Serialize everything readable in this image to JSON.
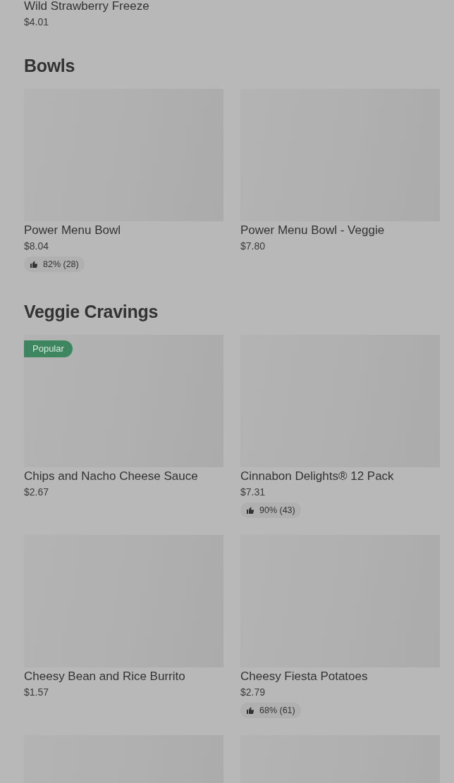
{
  "top_item": {
    "title": "Wild Strawberry Freeze",
    "price": "$4.01"
  },
  "sections": [
    {
      "heading": "Bowls",
      "items": [
        {
          "kind": "product",
          "title": "Power Menu Bowl",
          "price": "$8.04",
          "rating": "82% (28)"
        },
        {
          "kind": "product",
          "title": "Power Menu Bowl - Veggie",
          "price": "$7.80"
        }
      ]
    },
    {
      "heading": "Veggie Cravings",
      "items": [
        {
          "kind": "product",
          "badge": "Popular",
          "title": "Chips and Nacho Cheese Sauce",
          "price": "$2.67"
        },
        {
          "kind": "product",
          "title": "Cinnabon Delights® 12 Pack",
          "price": "$7.31",
          "rating": "90% (43)"
        },
        {
          "kind": "product",
          "title": "Cheesy Bean and Rice Burrito",
          "price": "$1.57"
        },
        {
          "kind": "product",
          "title": "Cheesy Fiesta Potatoes",
          "price": "$2.79",
          "rating": "68% (61)"
        },
        {
          "kind": "placeholder"
        },
        {
          "kind": "placeholder"
        }
      ]
    }
  ]
}
